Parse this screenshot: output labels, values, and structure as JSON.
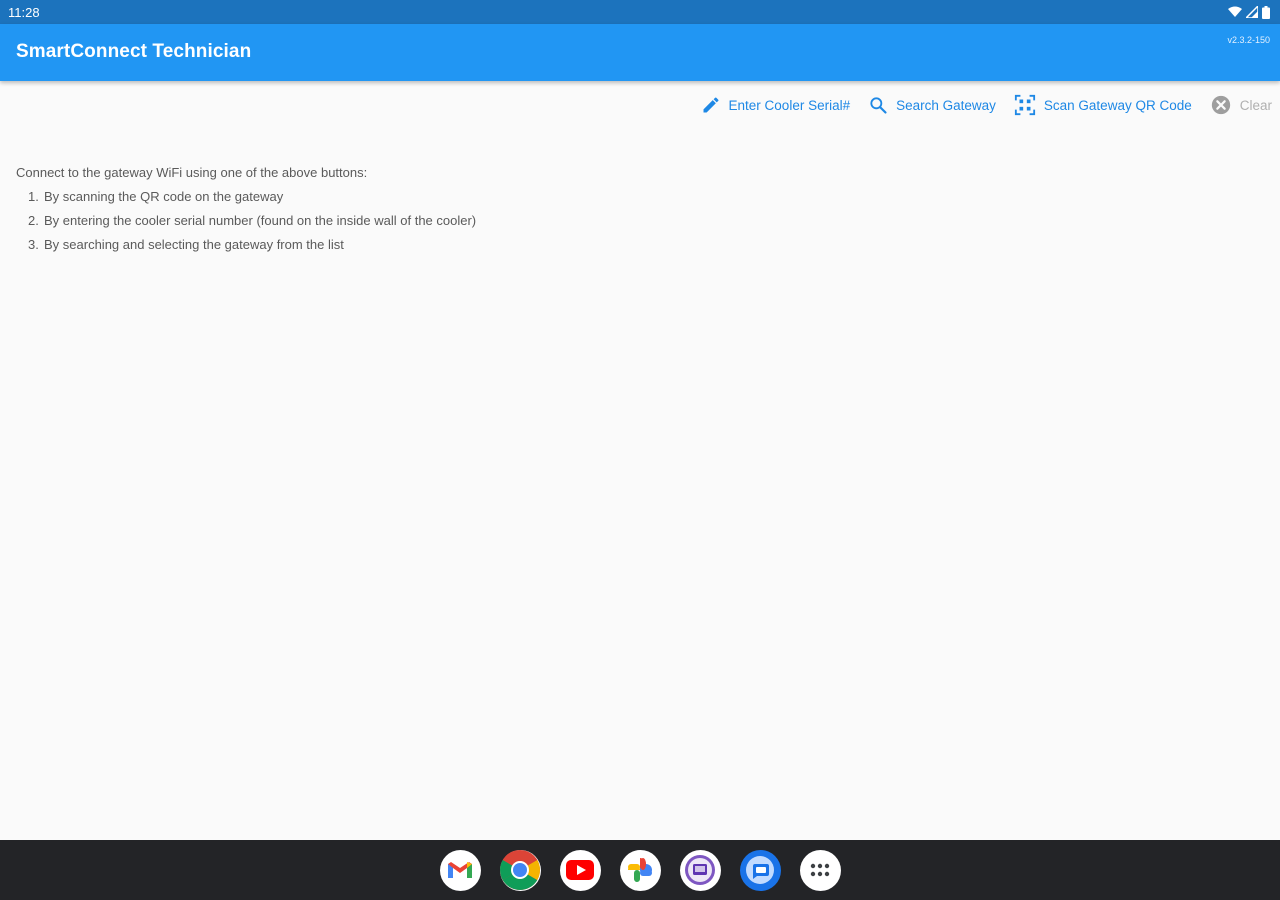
{
  "status_bar": {
    "time": "11:28"
  },
  "app_bar": {
    "title": "SmartConnect Technician",
    "version": "v2.3.2-150"
  },
  "toolbar": {
    "enter_serial_label": "Enter Cooler Serial#",
    "search_gateway_label": "Search Gateway",
    "scan_qr_label": "Scan Gateway QR Code",
    "clear_label": "Clear",
    "accent_color": "#1e88e5",
    "disabled_color": "#b0b0b0"
  },
  "instructions": {
    "intro": "Connect to the gateway WiFi using one of the above buttons:",
    "steps": [
      {
        "num": "1.",
        "text": "By scanning the QR code on the gateway"
      },
      {
        "num": "2.",
        "text": "By entering the cooler serial number (found on the inside wall of the cooler)"
      },
      {
        "num": "3.",
        "text": "By searching and selecting the gateway from the list"
      }
    ]
  },
  "dock": {
    "apps": [
      "gmail-icon",
      "chrome-icon",
      "youtube-icon",
      "photos-icon",
      "screen-recorder-icon",
      "messages-icon",
      "app-drawer-icon"
    ]
  },
  "colors": {
    "status_bar": "#1c73bd",
    "app_bar": "#2196f3",
    "background": "#fafafa",
    "dock": "#232427"
  }
}
